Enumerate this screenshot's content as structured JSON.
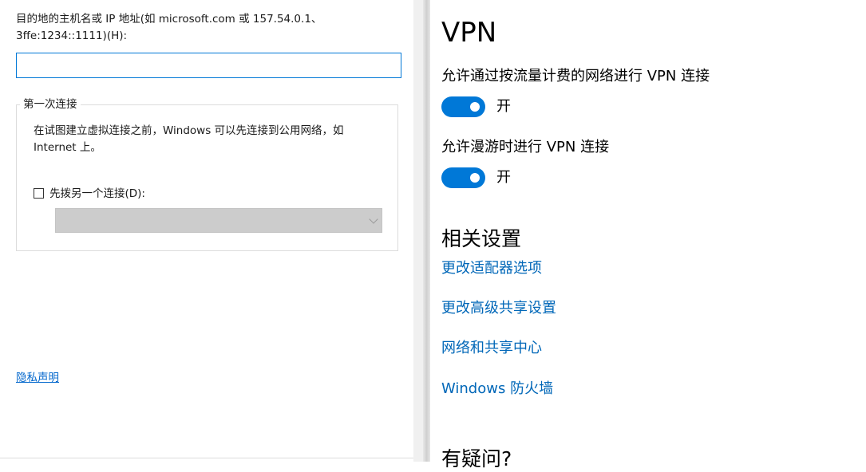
{
  "dialog": {
    "destination_label_line1": "目的地的主机名或 IP 地址(如 microsoft.com 或 157.54.0.1、",
    "destination_label_line2": "3ffe:1234::1111)(H):",
    "destination_value": "",
    "first_connection": {
      "legend": "第一次连接",
      "description_line1": "在试图建立虚拟连接之前，Windows 可以先连接到公用网络，如",
      "description_line2": "Internet 上。",
      "predial_label": "先拨另一个连接(D):",
      "predial_checked": false,
      "connection_selected": ""
    },
    "privacy_link": "隐私声明"
  },
  "settings": {
    "title": "VPN",
    "toggles": [
      {
        "label": "允许通过按流量计费的网络进行 VPN 连接",
        "state": "开",
        "on": true
      },
      {
        "label": "允许漫游时进行 VPN 连接",
        "state": "开",
        "on": true
      }
    ],
    "related_title": "相关设置",
    "related_links": [
      "更改适配器选项",
      "更改高级共享设置",
      "网络和共享中心",
      "Windows 防火墙"
    ],
    "question_title": "有疑问?"
  },
  "colors": {
    "accent": "#0078d7",
    "link": "#0067b8",
    "dialog_link": "#0066cc",
    "disabled_select": "#cccccc"
  }
}
